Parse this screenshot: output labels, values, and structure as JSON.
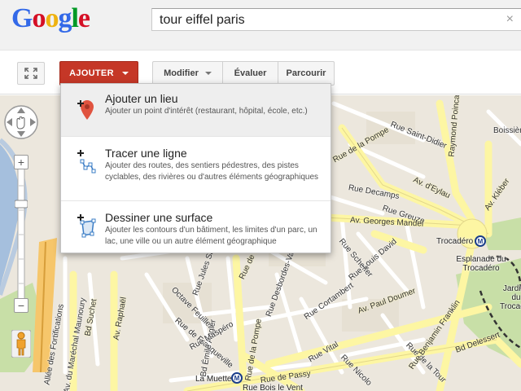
{
  "header": {
    "logo": [
      "G",
      "o",
      "o",
      "g",
      "l",
      "e"
    ],
    "search_value": "tour eiffel paris",
    "clear_glyph": "×"
  },
  "toolbar": {
    "fullscreen_icon": "expand-icon",
    "add_label": "AJOUTER",
    "modify_label": "Modifier",
    "rate_label": "Évaluer",
    "browse_label": "Parcourir"
  },
  "menu": {
    "items": [
      {
        "title": "Ajouter un lieu",
        "desc": "Ajouter un point d'intérêt (restaurant, hôpital, école, etc.)",
        "icon": "add-place-pin-icon"
      },
      {
        "title": "Tracer une ligne",
        "desc": "Ajouter des routes, des sentiers pédestres, des pistes cyclables, des rivières ou d'autres éléments géographiques",
        "icon": "draw-line-icon"
      },
      {
        "title": "Dessiner une surface",
        "desc": "Ajouter les contours d'un bâtiment, les limites d'un parc, un lac, une ville ou un autre élément géographique",
        "icon": "draw-shape-icon"
      }
    ]
  },
  "map": {
    "colors": {
      "land": "#ece7dd",
      "major_road": "#fdf6a3",
      "road": "#ffffff",
      "park": "#c8dfa7",
      "water": "#a5bfdd"
    },
    "streets": [
      "Rue Saint-Didier",
      "Raymond Poincaré",
      "Boissière",
      "Rue de la Pompe",
      "Av. d'Eylau",
      "Rue Decamps",
      "Av. Kléber",
      "Rue Greuze",
      "Av. Georges Mandel",
      "Rue Scheffer",
      "Rue Louis David",
      "Av. Paul Doumer",
      "Rue Cortambert",
      "Rue Desbordes-Valmore",
      "Rue de Siam",
      "Octave Feuillet",
      "Rue de Franqueville",
      "Bd Suchet",
      "Av. Raphaël",
      "Rue Mozart",
      "Bd Émile Augier",
      "Rue Maspéro",
      "Rue de la Pompe",
      "Rue Vital",
      "Rue Nicolo",
      "Rue de la Tour",
      "Bd Delessert",
      "Rue de Passy",
      "Rue Boulainvilliers",
      "La Muette",
      "Rue Benjamin Franklin",
      "Av. du Maréchal Maunoury",
      "Allée des Fortifications",
      "Bd Lannes",
      "Rue Sandeau",
      "Rue Boileau",
      "Rue Franklin",
      "Rue Jules Sandeau",
      "Rue Decamps"
    ],
    "places": [
      "Trocadéro",
      "Esplanade du Trocadéro",
      "Jardins du Trocadéro",
      "Rue Boileau",
      "Rue Bois le Vent"
    ],
    "metro_glyph": "M",
    "controls": {
      "zoom_in": "+",
      "zoom_out": "−"
    }
  }
}
